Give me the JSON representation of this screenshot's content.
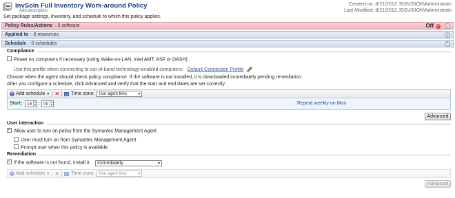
{
  "header": {
    "title": "InvSoln Full Inventory Work-around Policy",
    "description_placeholder": "Add description",
    "help_text": "Set package settings, inventory, and schedule to which this policy applies.",
    "created": "Created on: 8/21/2012 JSSVISION\\Administrato",
    "modified": "Last Modified: 8/21/2012 JSSVISION\\Administrato"
  },
  "bars": {
    "rules_label": "Policy Rules/Actions",
    "rules_count": "- 0 software",
    "status": "Off",
    "applied_label": "Applied to",
    "applied_count": "- 0 resources",
    "schedule_label": "Schedule",
    "schedule_count": "- 0 schedules"
  },
  "compliance": {
    "heading": "Compliance",
    "power_on": "Power on computers if necessary (using Wake-on-LAN, Intel AMT, ASF or DASH)",
    "oob_text": "Use this profile when connecting to out-of-band technology-enabled computers:",
    "oob_link": "Default Connection Profile",
    "info1": "Choose when the agent should check policy compliance. If the software is not installed, it is downloaded immediately pending remediation.",
    "info2": "After you configure a schedule, click Advanced and verify that the start and end dates are set correctly."
  },
  "schedule_toolbar": {
    "add_label": "Add schedule",
    "tz_label": "Time zone:",
    "tz_value": "Use agent time"
  },
  "schedule_row": {
    "start_label": "Start:",
    "hour": "18",
    "minute": "00",
    "repeat": "Repeat weekly on Mon"
  },
  "advanced_label": "Advanced",
  "user_interaction": {
    "heading": "User interaction",
    "allow": "Allow user to turn on policy from the Symantec Management Agent",
    "must": "User must turn on from Symantec Management Agent",
    "prompt": "Prompt user when this policy is available"
  },
  "remediation": {
    "heading": "Remediation",
    "install_label": "If the software is not found, install it:",
    "install_value": "Immediately",
    "add_label": "Add schedule",
    "tz_label": "Time zone:",
    "tz_value": "Use agent time",
    "advanced_label": "Advanced"
  }
}
